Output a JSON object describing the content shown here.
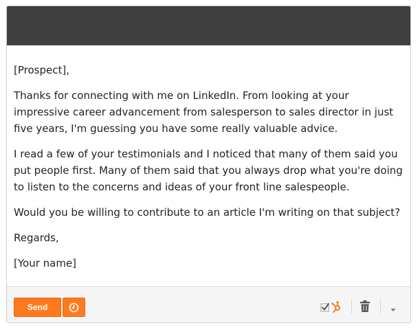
{
  "email": {
    "body": {
      "greeting": "[Prospect],",
      "paragraph_1": "Thanks for connecting with me on LinkedIn. From looking at your impressive career advancement from salesperson to sales director in just five years, I'm guessing you have some really valuable advice.",
      "paragraph_2": "I read a few of your testimonials and I noticed that many of them said you put people first. Many of them said that you always drop what you're doing to listen to the concerns and ideas of your front line salespeople.",
      "paragraph_3": "Would you be willing to contribute to an article I'm writing on that subject?",
      "sign_off": "Regards,",
      "signature": "[Your name]"
    }
  },
  "toolbar": {
    "send_label": "Send",
    "icons": {
      "schedule": "clock-icon",
      "hubspot": "hubspot-track-icon",
      "trash": "trash-icon",
      "more": "chevron-down-icon"
    }
  },
  "colors": {
    "titlebar": "#404040",
    "accent": "#ff7a1f",
    "toolbar_bg": "#f5f5f5",
    "text": "#222222"
  }
}
